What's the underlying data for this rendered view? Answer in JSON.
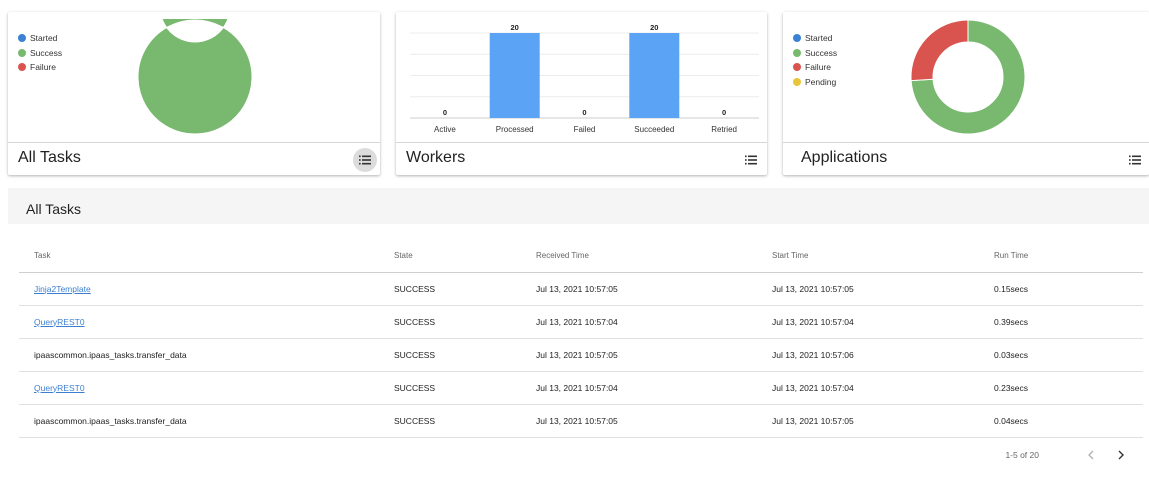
{
  "cards": {
    "tasks": {
      "title": "All Tasks",
      "legend": [
        {
          "label": "Started",
          "color": "#3b82d4"
        },
        {
          "label": "Success",
          "color": "#78b96f"
        },
        {
          "label": "Failure",
          "color": "#d9534f"
        }
      ]
    },
    "workers": {
      "title": "Workers"
    },
    "apps": {
      "title": "Applications",
      "legend": [
        {
          "label": "Started",
          "color": "#3b82d4"
        },
        {
          "label": "Success",
          "color": "#78b96f"
        },
        {
          "label": "Failure",
          "color": "#d9534f"
        },
        {
          "label": "Pending",
          "color": "#e8c53b"
        }
      ]
    }
  },
  "chart_data": [
    {
      "type": "pie",
      "labels": [
        "Started",
        "Success",
        "Failure"
      ],
      "values": [
        0,
        100,
        0
      ],
      "colors": [
        "#3b82d4",
        "#78b96f",
        "#d9534f"
      ]
    },
    {
      "type": "bar",
      "categories": [
        "Active",
        "Processed",
        "Failed",
        "Succeeded",
        "Retried"
      ],
      "values": [
        0,
        20,
        0,
        20,
        0
      ],
      "color": "#5ba4f5",
      "grid": true
    },
    {
      "type": "pie",
      "labels": [
        "Started",
        "Success",
        "Failure",
        "Pending"
      ],
      "values": [
        0,
        74,
        26,
        0
      ],
      "colors": [
        "#3b82d4",
        "#78b96f",
        "#d9534f",
        "#e8c53b"
      ]
    }
  ],
  "table": {
    "section_title": "All Tasks",
    "columns": [
      "Task",
      "State",
      "Received Time",
      "Start Time",
      "Run Time"
    ],
    "rows": [
      {
        "task": "Jinja2Template",
        "link": true,
        "state": "SUCCESS",
        "received": "Jul 13, 2021 10:57:05",
        "start": "Jul 13, 2021 10:57:05",
        "run": "0.15secs"
      },
      {
        "task": "QueryREST0",
        "link": true,
        "state": "SUCCESS",
        "received": "Jul 13, 2021 10:57:04",
        "start": "Jul 13, 2021 10:57:04",
        "run": "0.39secs"
      },
      {
        "task": "ipaascommon.ipaas_tasks.transfer_data",
        "link": false,
        "state": "SUCCESS",
        "received": "Jul 13, 2021 10:57:05",
        "start": "Jul 13, 2021 10:57:06",
        "run": "0.03secs"
      },
      {
        "task": "QueryREST0",
        "link": true,
        "state": "SUCCESS",
        "received": "Jul 13, 2021 10:57:04",
        "start": "Jul 13, 2021 10:57:04",
        "run": "0.23secs"
      },
      {
        "task": "ipaascommon.ipaas_tasks.transfer_data",
        "link": false,
        "state": "SUCCESS",
        "received": "Jul 13, 2021 10:57:05",
        "start": "Jul 13, 2021 10:57:05",
        "run": "0.04secs"
      }
    ]
  },
  "pagination": {
    "range": "1-5 of 20",
    "prev_icon": "chevron-left-icon",
    "next_icon": "chevron-right-icon"
  }
}
